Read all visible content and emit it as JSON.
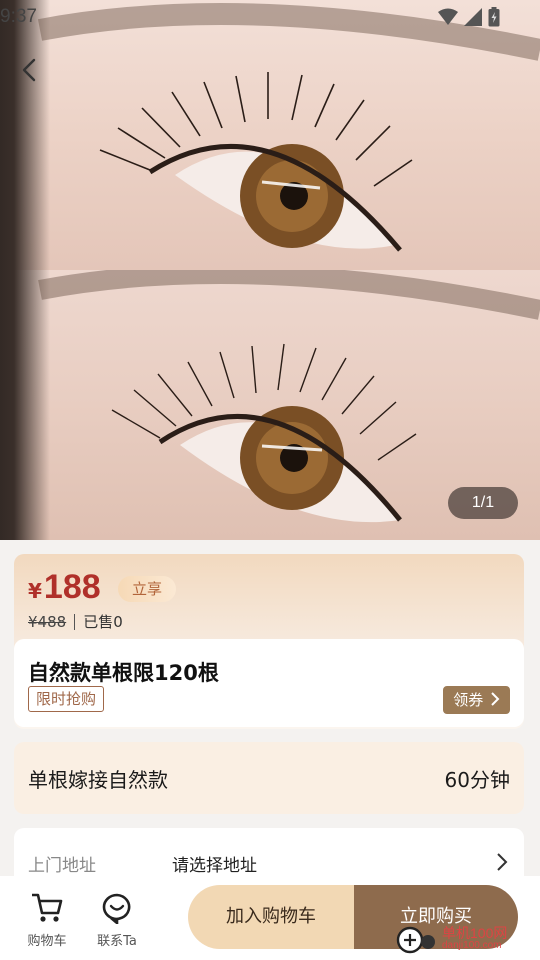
{
  "status_bar": {
    "time": "9:37",
    "icons": [
      "wifi-icon",
      "signal-icon",
      "battery-icon"
    ]
  },
  "gallery": {
    "counter": "1/1"
  },
  "price": {
    "currency_symbol": "¥",
    "current": "188",
    "enjoy_badge": "立享",
    "original": "¥488",
    "sold": "已售0",
    "accent_color": "#b0302a"
  },
  "product": {
    "title": "自然款单根限120根",
    "flash_tag": "限时抢购",
    "coupon_button": "领券"
  },
  "service": {
    "name": "单根嫁接自然款",
    "duration": "60分钟"
  },
  "address": {
    "label": "上门地址",
    "placeholder": "请选择地址"
  },
  "bottom_bar": {
    "cart_label": "购物车",
    "contact_label": "联系Ta",
    "add_to_cart": "加入购物车",
    "buy_now": "立即购买",
    "buy_color": "#8e6b4d"
  },
  "watermark": {
    "text": "单机100网",
    "sub": "danji100.com"
  }
}
